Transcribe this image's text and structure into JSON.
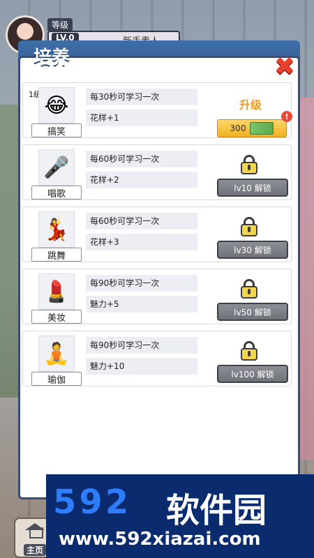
{
  "header": {
    "level_label": "等级",
    "level_value": "LV.0",
    "level_title": "新手素人"
  },
  "panel": {
    "title": "培养",
    "close_icon": "close-icon"
  },
  "skills": [
    {
      "row_level": "1级",
      "icon": "laughing-emoji",
      "name": "搞笑",
      "desc1": "每30秒可学习一次",
      "desc2": "花样+1",
      "action": "upgrade",
      "upgrade_label": "升级",
      "cost": "300",
      "badge": "!"
    },
    {
      "icon": "microphone",
      "name": "唱歌",
      "desc1": "每60秒可学习一次",
      "desc2": "花样+2",
      "action": "locked",
      "unlock_label": "lv10 解锁"
    },
    {
      "icon": "dancer",
      "name": "跳舞",
      "desc1": "每60秒可学习一次",
      "desc2": "花样+3",
      "action": "locked",
      "unlock_label": "lv30 解锁"
    },
    {
      "icon": "lipstick",
      "name": "美妆",
      "desc1": "每90秒可学习一次",
      "desc2": "魅力+5",
      "action": "locked",
      "unlock_label": "lv50 解锁"
    },
    {
      "icon": "yoga",
      "name": "瑜伽",
      "desc1": "每90秒可学习一次",
      "desc2": "魅力+10",
      "action": "locked",
      "unlock_label": "lv100 解锁"
    }
  ],
  "watermark": {
    "logo": "592",
    "text": "软件园",
    "url": "www.592xiazai.com"
  },
  "bottom": {
    "home_label": "主页"
  }
}
